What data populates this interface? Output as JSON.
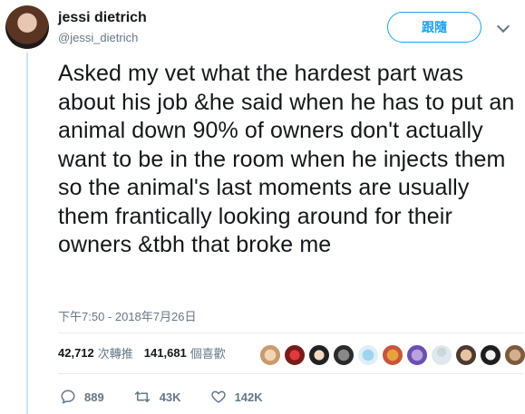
{
  "user": {
    "display_name": "jessi dietrich",
    "handle": "@jessi_dietrich"
  },
  "follow_label": "跟隨",
  "tweet_text": "Asked my vet what the hardest part was about his job &he said when he has to put an animal down 90% of owners don't actually want to be in the room when he injects them so the animal's last moments are usually them frantically looking around for their owners &tbh that broke me",
  "timestamp": "下午7:50 - 2018年7月26日",
  "stats": {
    "retweets_count": "42,712",
    "retweets_label": "次轉推",
    "likes_count": "141,681",
    "likes_label": "個喜歡"
  },
  "actions": {
    "reply_count": "889",
    "retweet_count": "43K",
    "like_count": "142K"
  },
  "colors": {
    "accent": "#1da1f2",
    "muted": "#657786",
    "thread_line": "#c4e4f6"
  },
  "icons": [
    "reply-icon",
    "retweet-icon",
    "heart-icon",
    "chevron-down-icon"
  ]
}
